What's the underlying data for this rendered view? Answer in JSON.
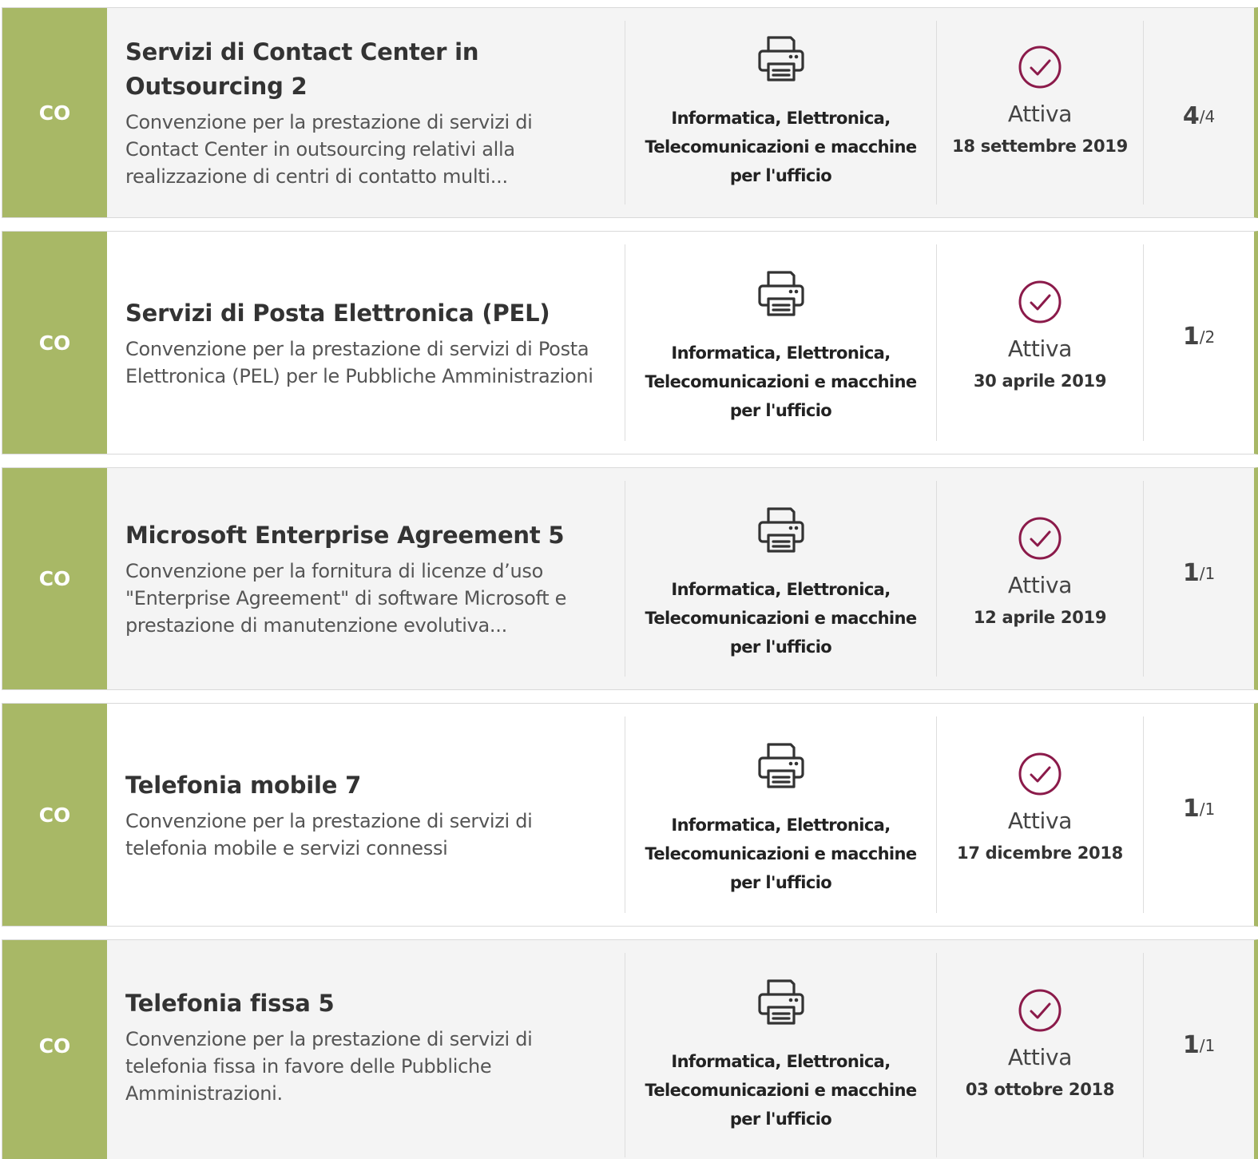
{
  "cards": [
    {
      "type_code": "CO",
      "title": "Servizi di Contact Center in Outsourcing 2",
      "description": "Convenzione per la prestazione di servizi di Contact Center in outsourcing relativi alla realizzazione di centri di contatto multi...",
      "category_icon": "printer-icon",
      "category": "Informatica, Elettronica, Telecomunicazioni e macchine per l'ufficio",
      "status_icon": "check-circle-icon",
      "status": "Attiva",
      "date": "18 settembre 2019",
      "count": "4",
      "count_sep": "/",
      "count_total": "4"
    },
    {
      "type_code": "CO",
      "title": "Servizi di Posta Elettronica (PEL)",
      "description": "Convenzione per la prestazione di servizi di Posta Elettronica (PEL) per le Pubbliche Amministrazioni",
      "category_icon": "printer-icon",
      "category": "Informatica, Elettronica, Telecomunicazioni e macchine per l'ufficio",
      "status_icon": "check-circle-icon",
      "status": "Attiva",
      "date": "30 aprile 2019",
      "count": "1",
      "count_sep": "/",
      "count_total": "2"
    },
    {
      "type_code": "CO",
      "title": "Microsoft Enterprise Agreement 5",
      "description": "Convenzione per la fornitura di licenze d’uso \"Enterprise Agreement\" di software Microsoft e prestazione di manutenzione evolutiva...",
      "category_icon": "printer-icon",
      "category": "Informatica, Elettronica, Telecomunicazioni e macchine per l'ufficio",
      "status_icon": "check-circle-icon",
      "status": "Attiva",
      "date": "12 aprile 2019",
      "count": "1",
      "count_sep": "/",
      "count_total": "1"
    },
    {
      "type_code": "CO",
      "title": "Telefonia mobile 7",
      "description": "Convenzione per la prestazione di servizi di telefonia mobile e servizi connessi",
      "category_icon": "printer-icon",
      "category": "Informatica, Elettronica, Telecomunicazioni e macchine per l'ufficio",
      "status_icon": "check-circle-icon",
      "status": "Attiva",
      "date": "17 dicembre 2018",
      "count": "1",
      "count_sep": "/",
      "count_total": "1"
    },
    {
      "type_code": "CO",
      "title": "Telefonia fissa 5",
      "description": "Convenzione per la prestazione di servizi di telefonia fissa in favore delle Pubbliche Amministrazioni.",
      "category_icon": "printer-icon",
      "category": "Informatica, Elettronica, Telecomunicazioni e macchine per l'ufficio",
      "status_icon": "check-circle-icon",
      "status": "Attiva",
      "date": "03 ottobre 2018",
      "count": "1",
      "count_sep": "/",
      "count_total": "1"
    }
  ],
  "colors": {
    "accent_green": "#a8b866",
    "status_purple": "#8b1a4a"
  }
}
